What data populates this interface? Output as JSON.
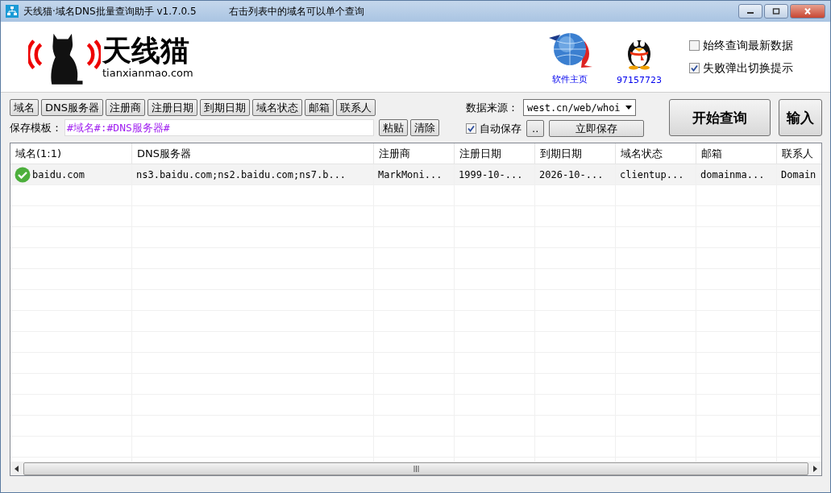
{
  "window": {
    "title": "天线猫·域名DNS批量查询助手 v1.7.0.5",
    "hint": "右击列表中的域名可以单个查询"
  },
  "logo": {
    "name": "天线猫",
    "domain": "tianxianmao.com"
  },
  "links": [
    {
      "kind": "globe",
      "label": "软件主页"
    },
    {
      "kind": "penguin",
      "label": "97157723"
    }
  ],
  "options": [
    {
      "label": "始终查询最新数据",
      "checked": false
    },
    {
      "label": "失败弹出切换提示",
      "checked": true
    }
  ],
  "field_buttons": [
    "域名",
    "DNS服务器",
    "注册商",
    "注册日期",
    "到期日期",
    "域名状态",
    "邮箱",
    "联系人"
  ],
  "template": {
    "label": "保存模板：",
    "value": "#域名#:#DNS服务器#",
    "buttons": [
      "粘贴",
      "清除"
    ]
  },
  "data_source": {
    "label": "数据来源：",
    "value": "west.cn/web/whoi"
  },
  "auto_save": {
    "label": "自动保存",
    "checked": true
  },
  "save_buttons": [
    "..",
    "立即保存"
  ],
  "start_button": "开始查询",
  "input_button": "输入",
  "table": {
    "columns": [
      "域名(1:1)",
      "DNS服务器",
      "注册商",
      "注册日期",
      "到期日期",
      "域名状态",
      "邮箱",
      "联系人"
    ],
    "rows": [
      {
        "kind": "ok",
        "cells": [
          "baidu.com",
          "ns3.baidu.com;ns2.baidu.com;ns7.b...",
          "MarkMoni...",
          "1999-10-...",
          "2026-10-...",
          "clientup...",
          "domainma...",
          "Domain"
        ]
      }
    ]
  }
}
